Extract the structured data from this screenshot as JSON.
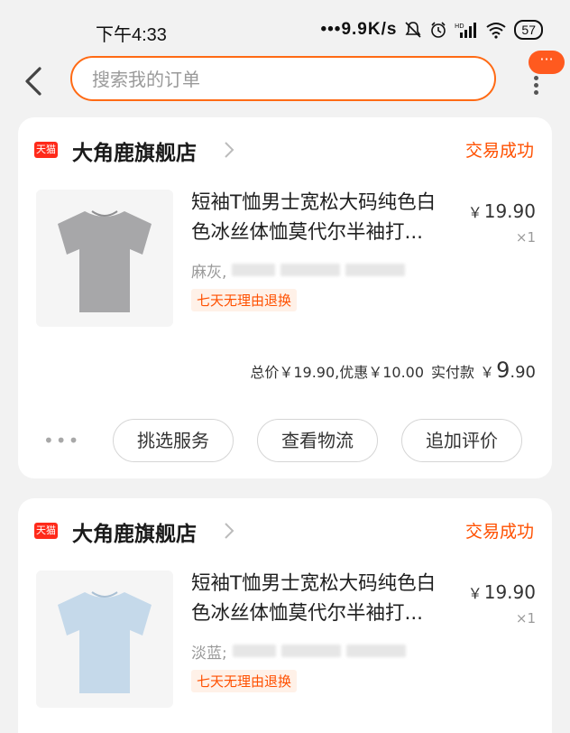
{
  "status_bar": {
    "time": "下午4:33",
    "network_speed": "•••9.9K/s",
    "battery": "57",
    "icons": [
      "mute-bell-icon",
      "alarm-icon",
      "hd-signal-icon",
      "wifi-icon",
      "battery-icon"
    ]
  },
  "header": {
    "search_placeholder": "搜索我的订单",
    "badge_text": "···"
  },
  "orders": [
    {
      "shop_name": "大角鹿旗舰店",
      "tmall_logo": "天猫",
      "status": "交易成功",
      "product": {
        "title": "短袖T恤男士宽松大码纯色白色冰丝体恤莫代尔半袖打底衫",
        "title_visible": "短袖T恤男士宽松大码纯色白色冰丝体恤莫代尔半袖打...",
        "sku_prefix": "麻灰,",
        "price": "19.90",
        "qty": "×1",
        "tag": "七天无理由退换",
        "color": "#a7a7a9"
      },
      "summary": {
        "total_text": "总价￥19.90,优惠￥10.00",
        "paid_label": "实付款",
        "paid_currency": "￥",
        "paid_int": "9",
        "paid_dec": ".90"
      },
      "actions": {
        "more": "•••",
        "select_service": "挑选服务",
        "view_logistics": "查看物流",
        "add_review": "追加评价"
      }
    },
    {
      "shop_name": "大角鹿旗舰店",
      "tmall_logo": "天猫",
      "status": "交易成功",
      "product": {
        "title_visible": "短袖T恤男士宽松大码纯色白色冰丝体恤莫代尔半袖打...",
        "sku_prefix": "淡蓝;",
        "price": "19.90",
        "qty": "×1",
        "tag": "七天无理由退换",
        "color": "#c5d9ea"
      }
    }
  ],
  "colors": {
    "accent": "#ff6a14",
    "status_orange": "#ff5000",
    "tmall_red": "#ff2a1a",
    "background": "#f2f2f2"
  }
}
